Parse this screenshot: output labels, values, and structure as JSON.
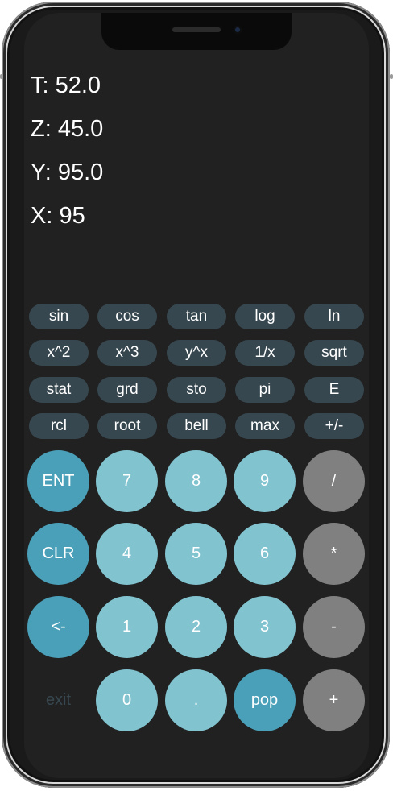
{
  "stack": {
    "t": "T: 52.0",
    "z": "Z: 45.0",
    "y": "Y: 95.0",
    "x": "X: 95"
  },
  "function_keys": [
    "sin",
    "cos",
    "tan",
    "log",
    "ln",
    "x^2",
    "x^3",
    "y^x",
    "1/x",
    "sqrt",
    "stat",
    "grd",
    "sto",
    "pi",
    "E",
    "rcl",
    "root",
    "bell",
    "max",
    "+/-"
  ],
  "keypad": {
    "ent": "ENT",
    "seven": "7",
    "eight": "8",
    "nine": "9",
    "divide": "/",
    "clr": "CLR",
    "four": "4",
    "five": "5",
    "six": "6",
    "multiply": "*",
    "back": "<-",
    "one": "1",
    "two": "2",
    "three": "3",
    "minus": "-",
    "exit": "exit",
    "zero": "0",
    "dot": ".",
    "pop": "pop",
    "plus": "+"
  },
  "colors": {
    "background": "#212121",
    "function_key": "#37474f",
    "digit_key": "#81c3cf",
    "accent_key": "#4aa0b8",
    "operator_key": "#808080"
  }
}
